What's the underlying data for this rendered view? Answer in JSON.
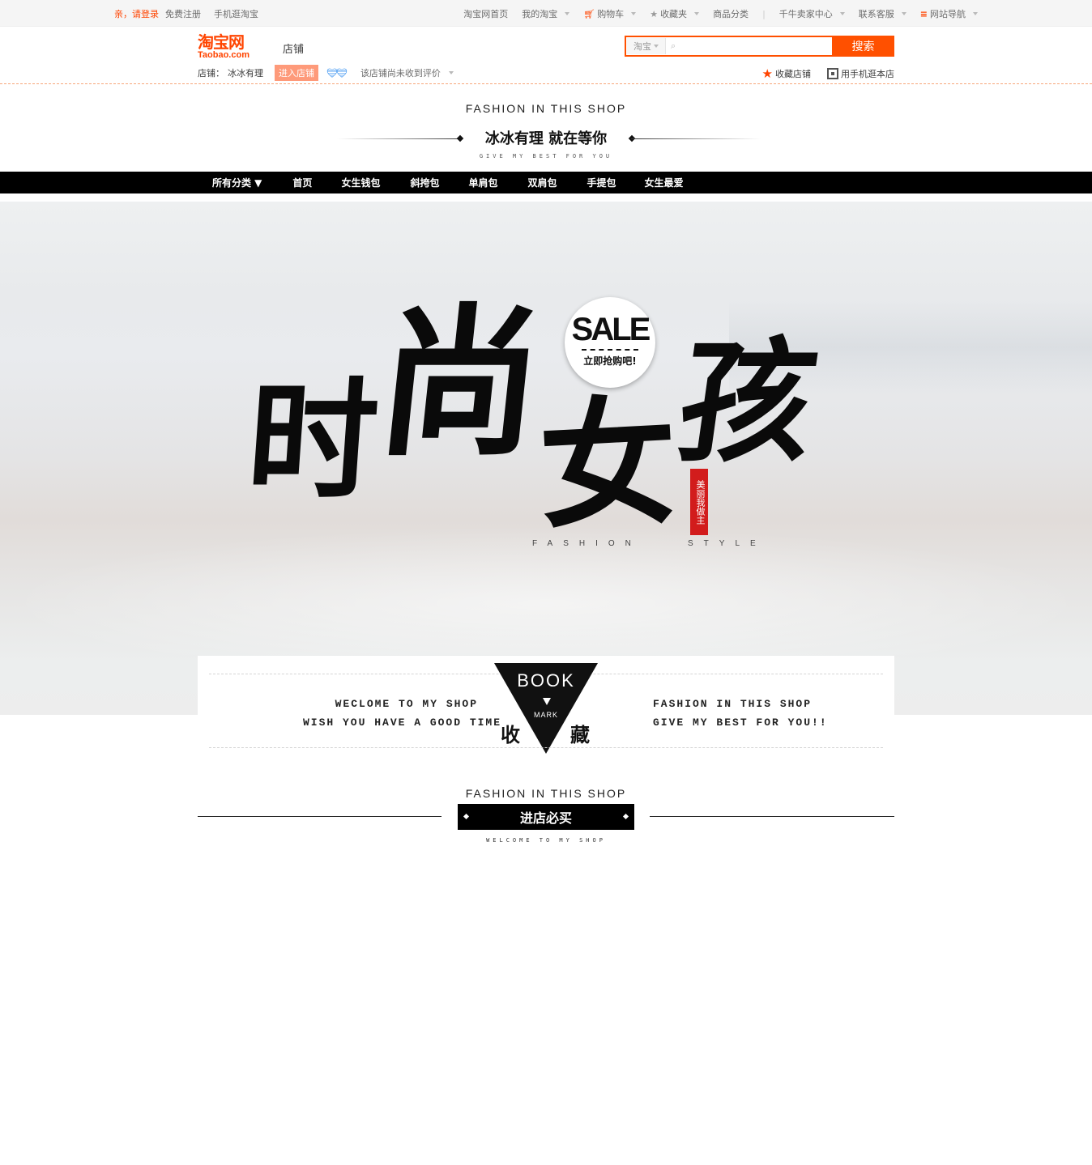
{
  "sitebar": {
    "login": "亲，请登录",
    "register": "免费注册",
    "mobile": "手机逛淘宝",
    "links": [
      {
        "label": "淘宝网首页",
        "icon": null,
        "caret": false
      },
      {
        "label": "我的淘宝",
        "icon": null,
        "caret": true
      },
      {
        "label": "购物车",
        "icon": "cart-icon",
        "caret": true
      },
      {
        "label": "收藏夹",
        "icon": "star-icon",
        "caret": true
      },
      {
        "label": "商品分类",
        "icon": null,
        "caret": false
      },
      {
        "label": "千牛卖家中心",
        "icon": null,
        "caret": true
      },
      {
        "label": "联系客服",
        "icon": null,
        "caret": true
      },
      {
        "label": "网站导航",
        "icon": "menu-icon",
        "caret": true
      }
    ]
  },
  "header": {
    "logo_cn": "淘宝网",
    "logo_en": "Taobao.com",
    "shop_label": "店铺",
    "search": {
      "scope": "淘宝",
      "placeholder": "",
      "button": "搜索"
    },
    "shop_prefix": "店铺：",
    "shop_name": "冰冰有理",
    "enter_shop": "进入店铺",
    "rating_text": "该店铺尚未收到评价",
    "favorite_shop": "收藏店铺",
    "mobile_shop": "用手机逛本店"
  },
  "sign": {
    "en_title": "FASHION IN THIS SHOP",
    "cn_title": "冰冰有理 就在等你",
    "tagline": "GIVE MY BEST FOR YOU"
  },
  "nav": {
    "items": [
      "所有分类 ▼",
      "首页",
      "女生钱包",
      "斜挎包",
      "单肩包",
      "双肩包",
      "手提包",
      "女生最爱"
    ]
  },
  "hero": {
    "calligraphy": [
      "时",
      "尚",
      "女",
      "孩"
    ],
    "seal_text": "美丽我做主",
    "sale_word": "SALE",
    "sale_cta": "立即抢购吧!",
    "fashion_left": "FASHION",
    "fashion_right": "STYLE"
  },
  "bookmark": {
    "left_line1": "WECLOME TO MY SHOP",
    "left_line2": "WISH YOU HAVE A GOOD TIME",
    "right_line1": "FASHION IN THIS SHOP",
    "right_line2": "GIVE MY BEST FOR YOU!!",
    "book": "BOOK",
    "mark": "MARK",
    "shou": "收",
    "cang": "藏"
  },
  "section": {
    "en": "FASHION IN THIS SHOP",
    "pill": "进店必买",
    "tiny": "WELCOME TO MY SHOP"
  },
  "colors": {
    "brand": "#ff4400",
    "search": "#ff5000",
    "enter_btn": "#fe9a7a",
    "nav_bg": "#000000",
    "seal": "#d21c1c"
  }
}
